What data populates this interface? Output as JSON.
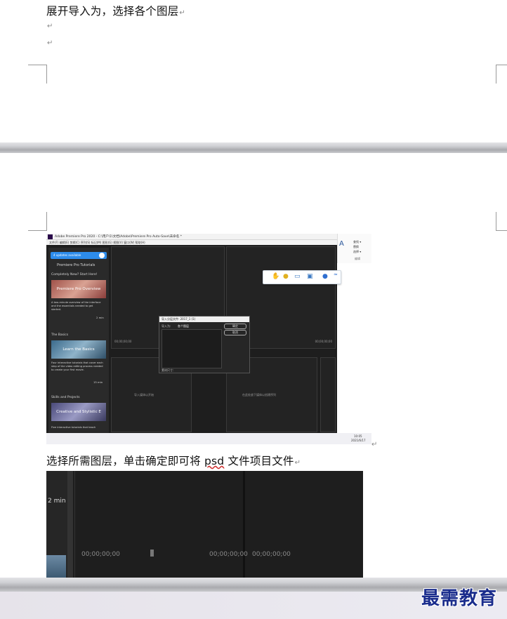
{
  "doc": {
    "line1": "展开导入为，选择各个图层",
    "para_mark": "↵",
    "line2_before": "选择所需图层，单击确定即可将 ",
    "line2_psd": "psd",
    "line2_after": " 文件项目文件"
  },
  "premiere": {
    "title": "Adobe Premiere Pro 2020 - C:\\用户\\1\\文档\\Adobe\\Premiere Pro Auto-Save\\未命名 *",
    "menu": "文件(F)  编辑(E)  剪辑(C)  序列(S)  标记(M)  图形(G)  视图(V)  窗口(W)  帮助(H)",
    "updates": "4 updates available",
    "tutorials_title": "Premiere Pro Tutorials",
    "sections": [
      {
        "heading": "Completely New? Start Here!",
        "card": "Premiere Pro Overview",
        "desc": "A two-minute overview of the interface and the essentials needed to get started.",
        "time": "2 min"
      },
      {
        "heading": "The Basics",
        "card": "Learn the Basics",
        "desc": "Four interactive tutorials that cover each step of the video editing process needed to create your first movie.",
        "time": "15 min"
      },
      {
        "heading": "Skills and Projects",
        "card": "Creative and Stylistic E",
        "desc": "Five interactive tutorials that teach",
        "time": ""
      }
    ],
    "timecode": "00;00;00;00",
    "dialog_title": "导入分层文件: 2017_1 (1)",
    "dialog_import_label": "导入为:",
    "dialog_import_value": "各个图层",
    "dialog_ok": "确定",
    "dialog_cancel": "取消",
    "dialog_size_label": "素材尺寸:",
    "project_hint": "导入媒体以开始",
    "timeline_hint": "在此处放下媒体以创建序列",
    "taskbar_time": "10:05",
    "taskbar_date": "2021/6/17",
    "ribbon_items": [
      "查找 ▾",
      "替换",
      "选择 ▾"
    ],
    "ribbon_group": "编辑"
  },
  "shot2": {
    "time_label": "2 min",
    "timecodes": [
      "00;00;00;00",
      "00;00;00;00",
      "00;00;00;00"
    ]
  },
  "watermark": "最需教育",
  "colors": {
    "watermark": "#1a2c8c",
    "update_badge": "#2d8ceb",
    "page_gap": "#bfc0c4"
  }
}
